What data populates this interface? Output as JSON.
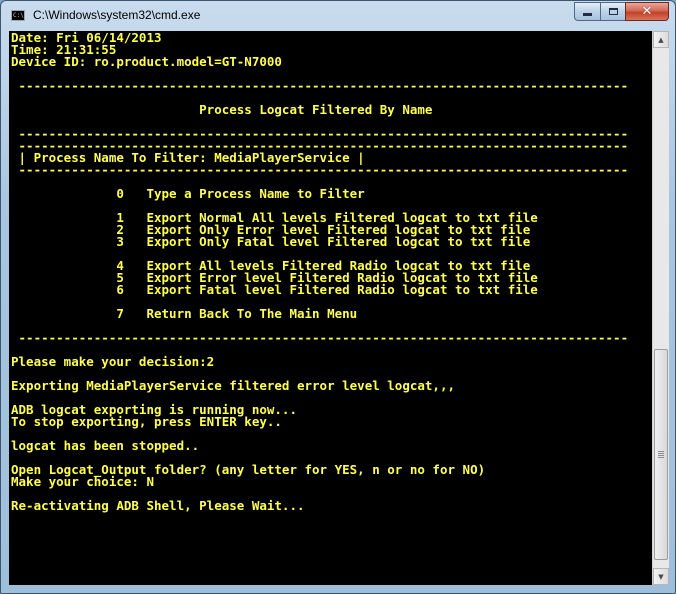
{
  "window": {
    "title": "C:\\Windows\\system32\\cmd.exe",
    "icon": "cmd-console-icon",
    "icon_text": "C:\\",
    "caption_buttons": {
      "minimize": "minimize-icon",
      "maximize": "maximize-icon",
      "close": "close-icon"
    }
  },
  "console": {
    "color": "#ffff54",
    "background": "#000000",
    "lines": [
      "Date: Fri 06/14/2013",
      "Time: 21:31:55",
      "Device ID: ro.product.model=GT-N7000",
      "",
      " ---------------------------------------------------------------------------------",
      "",
      "                         Process Logcat Filtered By Name",
      "",
      " ---------------------------------------------------------------------------------",
      " ---------------------------------------------------------------------------------",
      " | Process Name To Filter: MediaPlayerService |",
      " ---------------------------------------------------------------------------------",
      "",
      "              0   Type a Process Name to Filter",
      "",
      "              1   Export Normal All levels Filtered logcat to txt file",
      "              2   Export Only Error level Filtered logcat to txt file",
      "              3   Export Only Fatal level Filtered logcat to txt file",
      "",
      "              4   Export All levels Filtered Radio logcat to txt file",
      "              5   Export Error level Filtered Radio logcat to txt file",
      "              6   Export Fatal level Filtered Radio logcat to txt file",
      "",
      "              7   Return Back To The Main Menu",
      "",
      " ---------------------------------------------------------------------------------",
      "",
      "Please make your decision:2",
      "",
      "Exporting MediaPlayerService filtered error level logcat,,,",
      "",
      "ADB logcat exporting is running now...",
      "To stop exporting, press ENTER key..",
      "",
      "logcat has been stopped..",
      "",
      "Open Logcat_Output folder? (any letter for YES, n or no for NO)",
      "Make your choice: N",
      "",
      "Re-activating ADB Shell, Please Wait..."
    ]
  }
}
